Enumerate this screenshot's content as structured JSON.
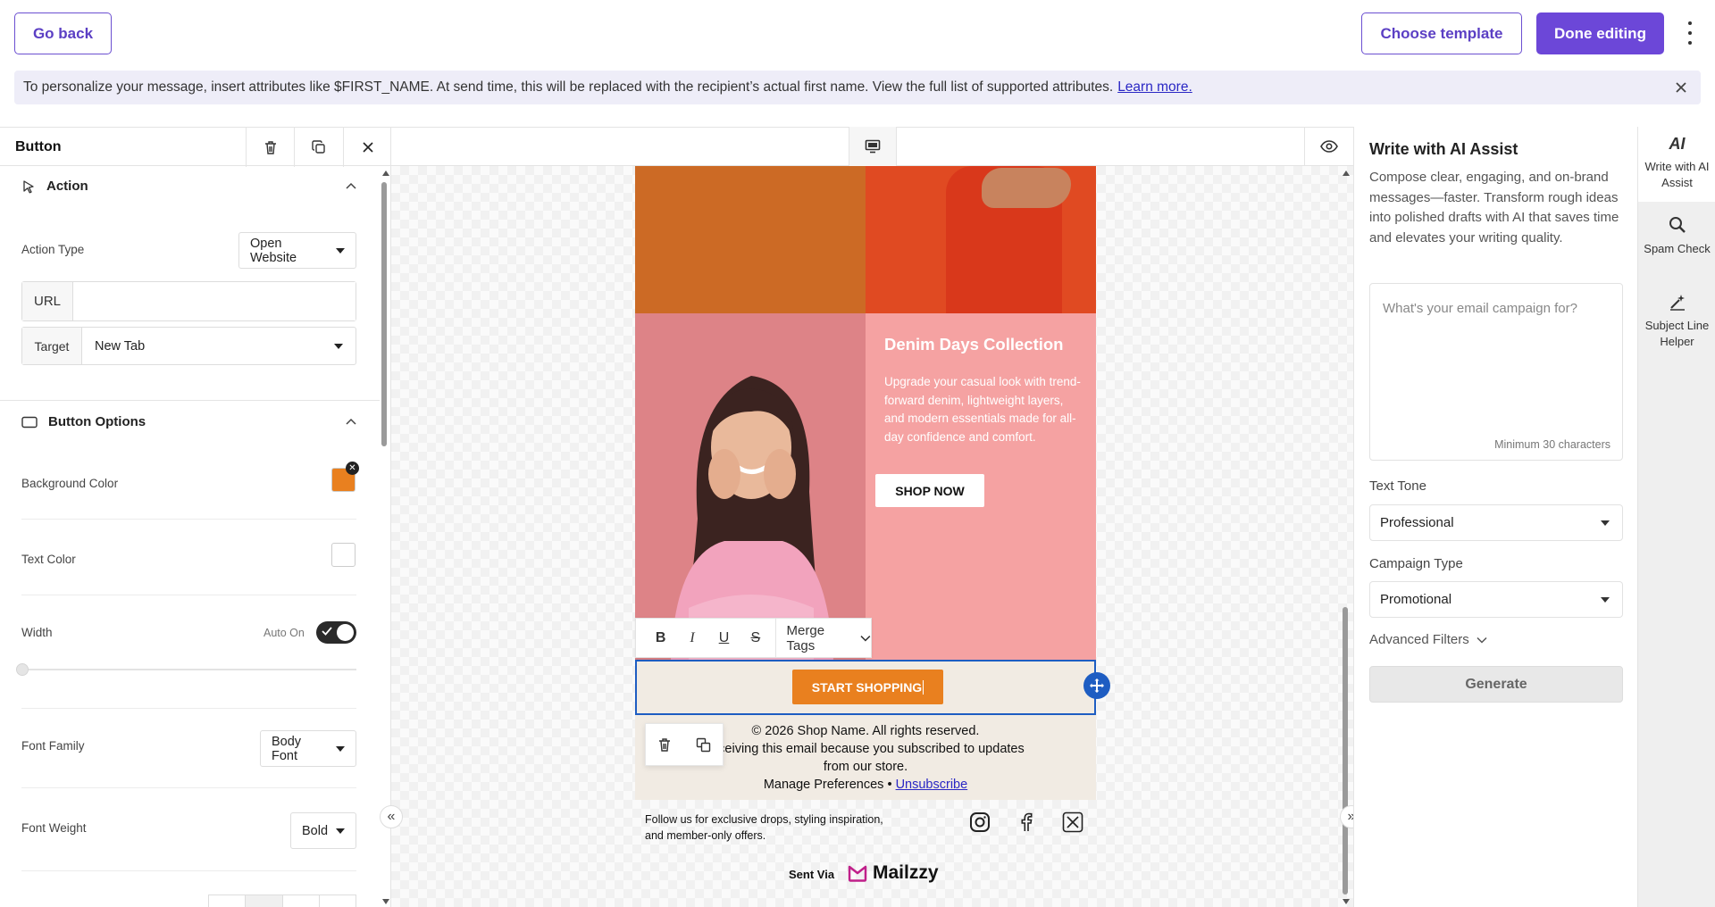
{
  "topbar": {
    "go_back": "Go back",
    "choose_template": "Choose template",
    "done_editing": "Done editing"
  },
  "notice": {
    "text": "To personalize your message, insert attributes like $FIRST_NAME. At send time, this will be replaced with the recipient’s actual first name. View the full list of supported attributes.",
    "link": "Learn more."
  },
  "left_panel": {
    "title": "Button",
    "action": {
      "heading": "Action",
      "action_type_label": "Action Type",
      "action_type_value": "Open Website",
      "url_label": "URL",
      "url_value": "",
      "target_label": "Target",
      "target_value": "New Tab"
    },
    "options": {
      "heading": "Button Options",
      "background_color_label": "Background Color",
      "background_color": "#e9801f",
      "text_color_label": "Text Color",
      "text_color": "#ffffff",
      "width_label": "Width",
      "width_auto_label": "Auto On",
      "font_family_label": "Font Family",
      "font_family_value": "Body Font",
      "font_weight_label": "Font Weight",
      "font_weight_value": "Bold"
    }
  },
  "email": {
    "collection_title": "Denim Days Collection",
    "collection_text": "Upgrade your casual look with trend-forward denim, lightweight layers, and modern essentials made for all-day confidence and comfort.",
    "shop_now": "SHOP NOW",
    "cta": "START SHOPPING",
    "merge_tags": "Merge Tags",
    "footer_line1": "© 2026 Shop Name. All rights reserved.",
    "footer_line2": "receiving this email because you subscribed to updates",
    "footer_line3": "from our store.",
    "manage_prefs": "Manage Preferences •",
    "unsubscribe": "Unsubscribe",
    "follow_text": "Follow us for exclusive drops, styling inspiration, and member-only offers.",
    "sent_via": "Sent Via",
    "brand": "Mailzzy"
  },
  "right_panel": {
    "title": "Write with AI Assist",
    "description": "Compose clear, engaging, and on-brand messages—faster. Transform rough ideas into polished drafts with AI that saves time and elevates your writing quality.",
    "placeholder": "What's your email campaign for?",
    "hint": "Minimum 30 characters",
    "text_tone_label": "Text Tone",
    "text_tone_value": "Professional",
    "campaign_type_label": "Campaign Type",
    "campaign_type_value": "Promotional",
    "advanced_filters": "Advanced Filters",
    "generate": "Generate"
  },
  "rail": {
    "ai_assist": "Write with AI Assist",
    "spam_check": "Spam Check",
    "subject_helper": "Subject Line Helper"
  },
  "colors": {
    "accent": "#6c47d8",
    "selection": "#1e5dc2",
    "cta": "#e9801f"
  }
}
